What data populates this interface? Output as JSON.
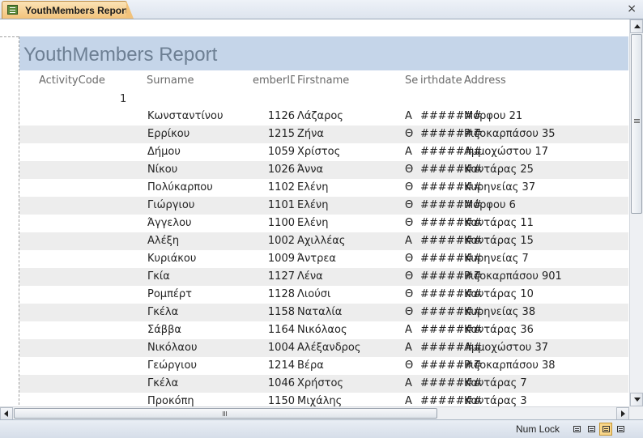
{
  "tab": {
    "label": "YouthMembers Report",
    "icon": "report-icon"
  },
  "close": {
    "glyph": "×"
  },
  "report": {
    "title": "YouthMembers Report",
    "headers": {
      "activity_code": "ActivityCode",
      "surname": "Surname",
      "member_id": "emberID",
      "firstname": "Firstname",
      "sex": "Se",
      "birthdate": "irthdate",
      "address": "Address"
    },
    "group_value": "1",
    "rows": [
      {
        "surname": "Κωνσταντίνου",
        "id": "1126",
        "first": "Λάζαρος",
        "sex": "Α",
        "bd": "#######",
        "addr": "Μόρφου 21"
      },
      {
        "surname": "Ερρίκου",
        "id": "1215",
        "first": "Ζήνα",
        "sex": "Θ",
        "bd": "#######",
        "addr": "Ριζοκαρπάσου 35"
      },
      {
        "surname": "Δήμου",
        "id": "1059",
        "first": "Χρίστος",
        "sex": "Α",
        "bd": "#######",
        "addr": "Αμμοχώστου 17"
      },
      {
        "surname": "Νίκου",
        "id": "1026",
        "first": "Άννα",
        "sex": "Θ",
        "bd": "#######",
        "addr": "Καντάρας 25"
      },
      {
        "surname": "Πολύκαρπου",
        "id": "1102",
        "first": "Ελένη",
        "sex": "Θ",
        "bd": "#######",
        "addr": "Κυρηνείας 37"
      },
      {
        "surname": "Γιώργιου",
        "id": "1101",
        "first": "Ελένη",
        "sex": "Θ",
        "bd": "#######",
        "addr": "Μόρφου 6"
      },
      {
        "surname": "Άγγελου",
        "id": "1100",
        "first": "Ελένη",
        "sex": "Θ",
        "bd": "#######",
        "addr": "Καντάρας 11"
      },
      {
        "surname": "Αλέξη",
        "id": "1002",
        "first": "Αχιλλέας",
        "sex": "Α",
        "bd": "#######",
        "addr": "Καντάρας 15"
      },
      {
        "surname": "Κυριάκου",
        "id": "1009",
        "first": "Άντρεα",
        "sex": "Θ",
        "bd": "#######",
        "addr": "Κυρηνείας 7"
      },
      {
        "surname": "Γκία",
        "id": "1127",
        "first": "Λένα",
        "sex": "Θ",
        "bd": "#######",
        "addr": "Ριζοκαρπάσου 901"
      },
      {
        "surname": "Ρομπέρτ",
        "id": "1128",
        "first": "Λιούσι",
        "sex": "Θ",
        "bd": "#######",
        "addr": "Καντάρας 10"
      },
      {
        "surname": "Γκέλα",
        "id": "1158",
        "first": "Ναταλία",
        "sex": "Θ",
        "bd": "#######",
        "addr": "Κυρηνείας 38"
      },
      {
        "surname": "Σάββα",
        "id": "1164",
        "first": "Νικόλαος",
        "sex": "Α",
        "bd": "#######",
        "addr": "Καντάρας 36"
      },
      {
        "surname": "Νικόλαου",
        "id": "1004",
        "first": "Αλέξανδρος",
        "sex": "Α",
        "bd": "#######",
        "addr": "Αμμοχώστου 37"
      },
      {
        "surname": "Γεώργιου",
        "id": "1214",
        "first": "Βέρα",
        "sex": "Θ",
        "bd": "#######",
        "addr": "Ριζοκαρπάσου 38"
      },
      {
        "surname": "Γκέλα",
        "id": "1046",
        "first": "Χρήστος",
        "sex": "Α",
        "bd": "#######",
        "addr": "Καντάρας 7"
      },
      {
        "surname": "Προκόπη",
        "id": "1150",
        "first": "Μιχάλης",
        "sex": "Α",
        "bd": "#######",
        "addr": "Καντάρας 3"
      }
    ]
  },
  "status": {
    "num_lock": "Num Lock",
    "views": [
      "report-view-icon",
      "print-preview-icon",
      "layout-view-icon",
      "design-view-icon"
    ]
  },
  "colors": {
    "tab_accent": "#f2c27a",
    "title_band": "#c5d5e9",
    "title_text": "#6d7f93",
    "alt_row": "#ededed"
  }
}
